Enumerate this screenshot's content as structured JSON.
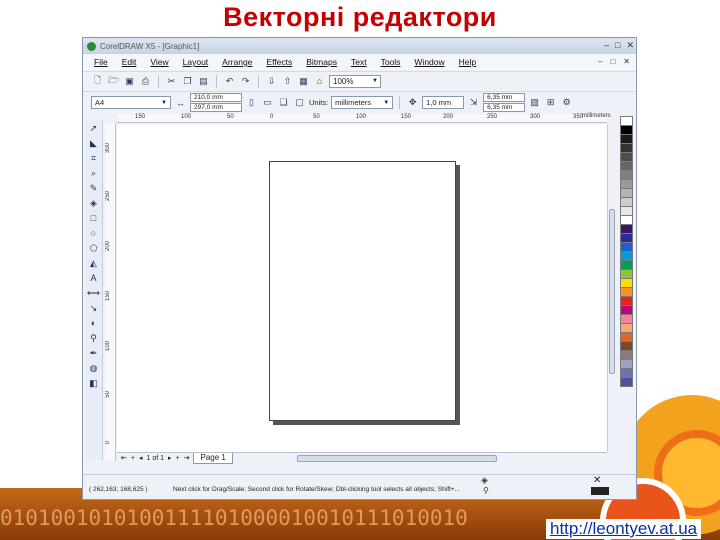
{
  "slide": {
    "title": "Векторні редактори",
    "binary_text": "0101001010100111101000010010111010010",
    "url": "http://leontyev.at.ua"
  },
  "app": {
    "title": "CorelDRAW X5 - [Graphic1]",
    "window_controls": [
      "–",
      "□",
      "✕"
    ],
    "doc_controls": [
      "–",
      "□",
      "✕"
    ],
    "menu": [
      "File",
      "Edit",
      "View",
      "Layout",
      "Arrange",
      "Effects",
      "Bitmaps",
      "Text",
      "Tools",
      "Window",
      "Help"
    ],
    "standard_toolbar": {
      "icons": [
        "new-icon",
        "open-icon",
        "save-icon",
        "print-icon",
        "cut-icon",
        "copy-icon",
        "paste-icon",
        "undo-icon",
        "redo-icon",
        "import-icon",
        "export-icon",
        "app-launcher-icon",
        "welcome-icon"
      ],
      "zoom": "100%"
    },
    "property_bar": {
      "paper_size": "A4",
      "width": "210,0 mm",
      "height": "297,0 mm",
      "units_label": "Units:",
      "units": "millimeters",
      "nudge": "1,0 mm",
      "dup_x": "6,35 mm",
      "dup_y": "6,35 mm"
    },
    "toolbox_icons": [
      "pick-tool-icon",
      "shape-tool-icon",
      "crop-tool-icon",
      "zoom-tool-icon",
      "freehand-tool-icon",
      "smart-fill-tool-icon",
      "rectangle-tool-icon",
      "ellipse-tool-icon",
      "polygon-tool-icon",
      "basic-shapes-tool-icon",
      "text-tool-icon",
      "parallel-dimension-tool-icon",
      "straight-connector-tool-icon",
      "blend-tool-icon",
      "eyedropper-tool-icon",
      "outline-pen-tool-icon",
      "fill-tool-icon",
      "interactive-fill-tool-icon"
    ],
    "hruler_ticks": [
      "150",
      "100",
      "50",
      "0",
      "50",
      "100",
      "150",
      "200",
      "250",
      "300",
      "350"
    ],
    "ruler_unit": "millimeters",
    "vruler_ticks": [
      "300",
      "250",
      "200",
      "150",
      "100",
      "50",
      "0"
    ],
    "page_nav": {
      "counter": "1 of 1",
      "tab": "Page 1"
    },
    "status": {
      "coords": "( 262,163; 168,625 )",
      "hint": "Next click for Drag/Scale; Second click for Rotate/Skew; Dbl-clicking tool selects all objects; Shift+..."
    },
    "palette": [
      "#ffffff",
      "#000000",
      "#1a1a1a",
      "#333333",
      "#4d4d4d",
      "#666666",
      "#808080",
      "#999999",
      "#b3b3b3",
      "#cccccc",
      "#e6e6e6",
      "#ffffff",
      "#3c1466",
      "#2a2a9c",
      "#1f5fd6",
      "#00a0d6",
      "#00a050",
      "#8cc63f",
      "#ffde00",
      "#f7941d",
      "#e0261a",
      "#c4007a",
      "#ee82a0",
      "#f9a870",
      "#d8672a",
      "#7a4a2a",
      "#8b7b7b",
      "#a0a0c8",
      "#7070b0",
      "#5050a0"
    ]
  }
}
